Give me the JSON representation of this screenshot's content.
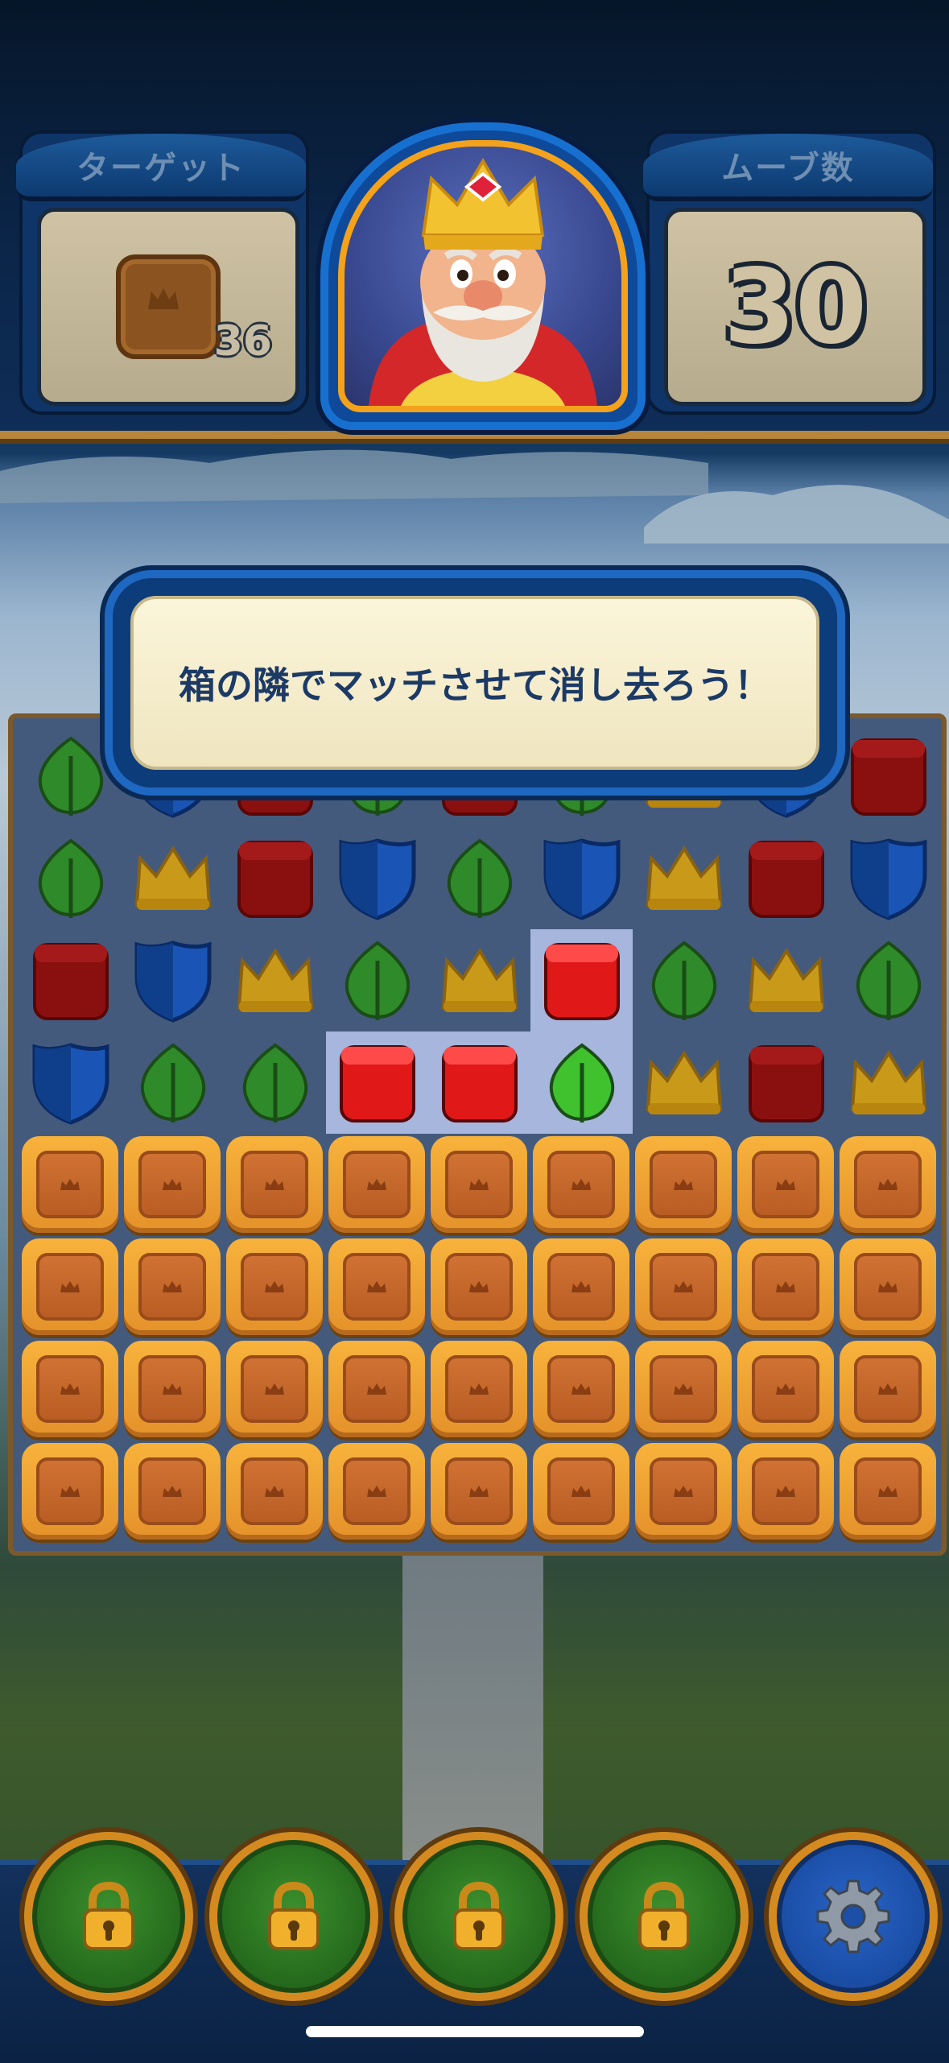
{
  "hud": {
    "target_label": "ターゲット",
    "target_count": "36",
    "moves_label": "ムーブ数",
    "moves_value": "30"
  },
  "tutorial": {
    "message": "箱の隣でマッチさせて消し去ろう！"
  },
  "board": {
    "columns": 9,
    "visible_rows": [
      [
        "leaf",
        "shield",
        "box",
        "leaf",
        "box",
        "leaf",
        "crown",
        "shield",
        "box"
      ],
      [
        "leaf",
        "crown",
        "box",
        "shield",
        "leaf",
        "shield",
        "crown",
        "box",
        "shield"
      ],
      [
        "box",
        "shield",
        "crown",
        "leaf",
        "crown",
        "box-bright",
        "leaf",
        "crown",
        "leaf"
      ],
      [
        "shield",
        "leaf",
        "leaf",
        "box-bright",
        "box-bright",
        "leaf-bright",
        "crown",
        "box",
        "crown"
      ]
    ],
    "crate_rows": 4,
    "highlighted_cells": [
      [
        2,
        5
      ],
      [
        3,
        3
      ],
      [
        3,
        4
      ],
      [
        3,
        5
      ]
    ]
  },
  "bottom_bar": {
    "buttons": [
      "lock-icon",
      "lock-icon",
      "lock-icon",
      "lock-icon",
      "gear-icon"
    ]
  },
  "colors": {
    "leaf": "#2f8a2a",
    "leaf_bright": "#3fc22e",
    "shield": "#0f3f8a",
    "box": "#8a1010",
    "box_bright": "#e11818",
    "crown": "#c99a1a",
    "crate": "#f1a332"
  }
}
